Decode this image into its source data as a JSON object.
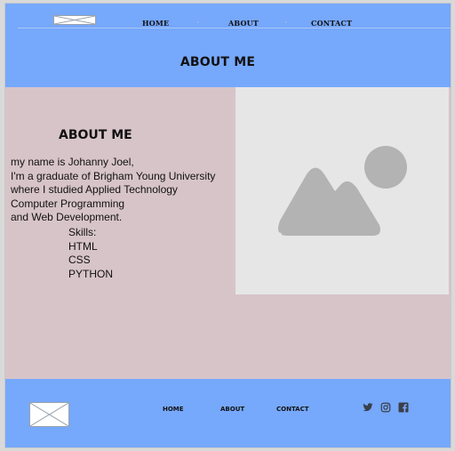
{
  "nav": {
    "items": [
      {
        "label": "HOME"
      },
      {
        "label": "ABOUT"
      },
      {
        "label": "CONTACT"
      }
    ]
  },
  "header": {
    "title": "ABOUT ME"
  },
  "main": {
    "section_title": "ABOUT ME",
    "bio_lines": [
      "my name is Johanny Joel,",
      "I'm a graduate of Brigham Young University",
      "where I studied Applied Technology",
      "Computer Programming",
      "and Web Development."
    ],
    "skills_title": "Skills:",
    "skills": [
      "HTML",
      "CSS",
      "PYTHON"
    ],
    "image_icon": "image-placeholder-icon"
  },
  "footer": {
    "nav": [
      {
        "label": "HOME"
      },
      {
        "label": "ABOUT"
      },
      {
        "label": "CONTACT"
      }
    ],
    "social_icons": [
      "twitter-icon",
      "instagram-icon",
      "facebook-icon"
    ]
  },
  "colors": {
    "header_bg": "#76a8fb",
    "page_bg": "#d7c4c9",
    "image_bg": "#e6e6e6",
    "icon_gray": "#b3b3b3",
    "social_icon": "#3a3f48"
  }
}
